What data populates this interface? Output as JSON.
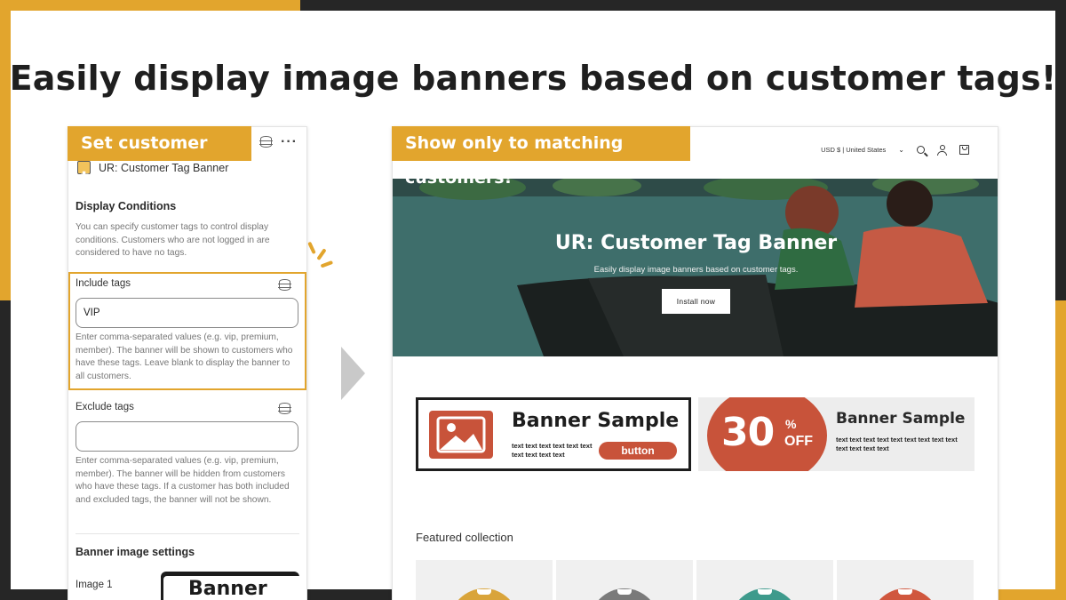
{
  "headline": "Easily display image banners based on customer tags!",
  "settings_panel": {
    "label": "Set customer tags...",
    "block_title": "UR: Customer Tag Banner",
    "display_conditions": {
      "title": "Display Conditions",
      "help": "You can specify customer tags to control display conditions. Customers who are not logged in are considered to have no tags."
    },
    "include_tags": {
      "label": "Include tags",
      "value": "VIP",
      "help": "Enter comma-separated values (e.g. vip, premium, member). The banner will be shown to customers who have these tags. Leave blank to display the banner to all customers."
    },
    "exclude_tags": {
      "label": "Exclude tags",
      "value": "",
      "help": "Enter comma-separated values (e.g. vip, premium, member). The banner will be hidden from customers who have these tags. If a customer has both included and excluded tags, the banner will not be shown."
    },
    "banner_image_settings": {
      "title": "Banner image settings",
      "image1_label": "Image 1",
      "image1_preview_text": "Banner Sa"
    }
  },
  "storefront": {
    "label": "Show only to matching customers!",
    "currency": "USD $ | United States",
    "hero": {
      "title": "UR: Customer Tag Banner",
      "subtitle": "Easily display image banners based on customer tags.",
      "button": "Install now"
    },
    "banner1": {
      "title": "Banner Sample",
      "text": "text text text text text text text text text text",
      "button": "button"
    },
    "banner2": {
      "number": "30",
      "percent": "%",
      "off": "OFF",
      "title": "Banner Sample",
      "text": "text text text text text text text text text text text text text"
    },
    "featured_title": "Featured collection",
    "product_colors": [
      "#d9a43a",
      "#7a7a7a",
      "#3e9a8c",
      "#d0573e"
    ]
  },
  "colors": {
    "accent": "#e2a52d",
    "banner_red": "#c8533a",
    "hero_teal": "#3e6e6b"
  }
}
